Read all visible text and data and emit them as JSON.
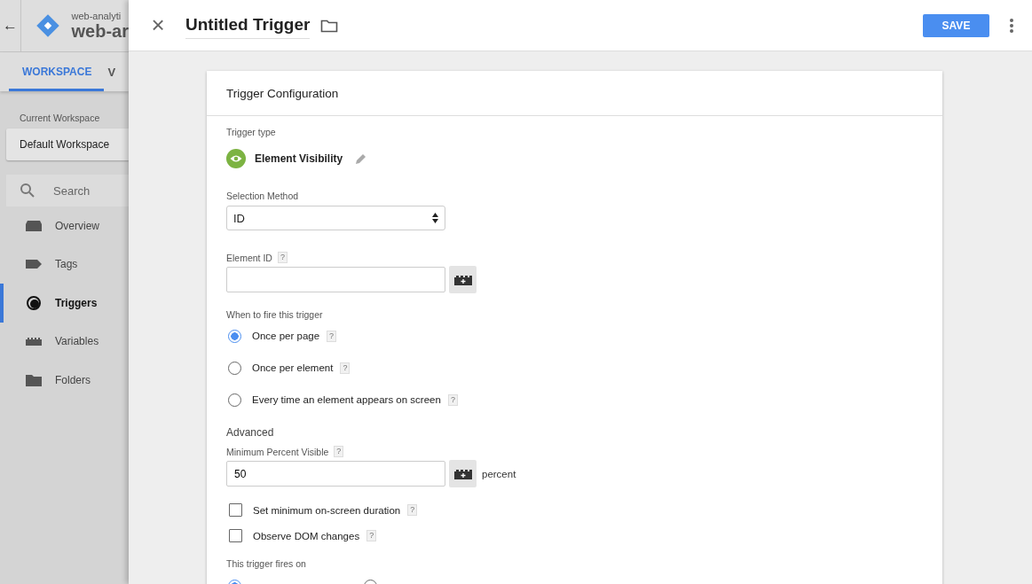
{
  "app": {
    "back": "←",
    "container_label": "web-analyti",
    "container_name": "web-ar"
  },
  "app_tabs": [
    {
      "label": "WORKSPACE",
      "selected": true
    },
    {
      "label": "V",
      "selected": false
    }
  ],
  "workspace": {
    "label": "Current Workspace",
    "name": "Default Workspace"
  },
  "search": {
    "placeholder": "Search"
  },
  "nav": [
    {
      "label": "Overview",
      "selected": false
    },
    {
      "label": "Tags",
      "selected": false
    },
    {
      "label": "Triggers",
      "selected": true
    },
    {
      "label": "Variables",
      "selected": false
    },
    {
      "label": "Folders",
      "selected": false
    }
  ],
  "editor": {
    "close": "×",
    "title": "Untitled Trigger",
    "save": "SAVE"
  },
  "card": {
    "title": "Trigger Configuration",
    "trigger_type_label": "Trigger type",
    "trigger_type": "Element Visibility",
    "selection_label": "Selection Method",
    "selection_value": "ID",
    "element_id_label": "Element ID",
    "element_id_help": "?",
    "when_label": "When to fire this trigger",
    "when_options": [
      {
        "label": "Once per page",
        "help": "?",
        "selected": true
      },
      {
        "label": "Once per element",
        "help": "?",
        "selected": false
      },
      {
        "label": "Every time an element appears on screen",
        "help": "?",
        "selected": false
      }
    ],
    "advanced_label": "Advanced",
    "min_percent_label": "Minimum Percent Visible",
    "min_percent_help": "?",
    "min_percent_value": "50",
    "min_percent_unit": "percent",
    "checkboxes": [
      {
        "label": "Set minimum on-screen duration",
        "help": "?",
        "checked": false
      },
      {
        "label": "Observe DOM changes",
        "help": "?",
        "checked": false
      }
    ],
    "fires_on_label": "This trigger fires on",
    "fires_on_options": [
      {
        "selected": true
      },
      {
        "selected": false
      }
    ]
  }
}
